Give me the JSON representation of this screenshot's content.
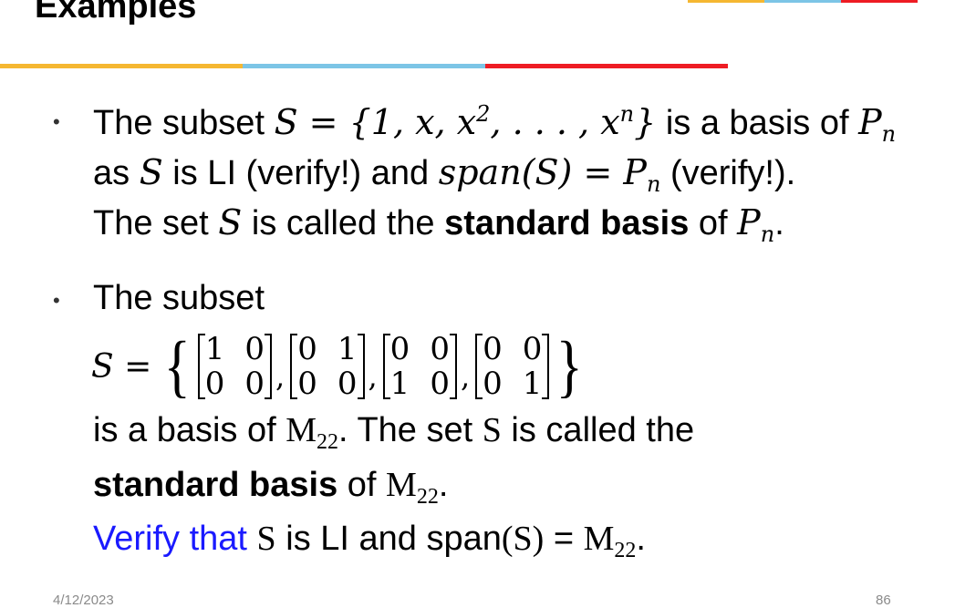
{
  "slide": {
    "title": "Examples",
    "top_accent_colors": [
      "#f5b731",
      "#7cc5e6",
      "#ee1c24"
    ],
    "rule_colors": [
      "#f5b731",
      "#7cc5e6",
      "#ee1c24"
    ],
    "bullet_glyph": "•"
  },
  "bullet1": {
    "l1_a": "The subset ",
    "l1_math": "S = {1, x, x",
    "l1_sup2": "2",
    "l1_math2": ", . . . , x",
    "l1_supn": "n",
    "l1_close": "}",
    "l1_b": " is a basis of ",
    "l1_P": "P",
    "l1_n": "n",
    "l2_a": "as ",
    "l2_S": "S",
    "l2_b": " is LI (verify!) and ",
    "l2_span": "span(S) = P",
    "l2_n": "n",
    "l2_c": " (verify!).",
    "l3_a": "The set ",
    "l3_S": "S",
    "l3_b": " is called the ",
    "l3_bold": "standard basis",
    "l3_c": " of ",
    "l3_P": "P",
    "l3_n": "n",
    "l3_dot": "."
  },
  "bullet2": {
    "l1": "The subset",
    "set_lhs": "S =",
    "matrices": [
      [
        "1",
        "0",
        "0",
        "0"
      ],
      [
        "0",
        "1",
        "0",
        "0"
      ],
      [
        "0",
        "0",
        "1",
        "0"
      ],
      [
        "0",
        "0",
        "0",
        "1"
      ]
    ],
    "l3_a": "is a basis of ",
    "l3_M": "M",
    "l3_sub": "22",
    "l3_b": ". The set ",
    "l3_S": "S",
    "l3_c": " is called the",
    "l4_bold": "standard basis",
    "l4_a": " of ",
    "l4_M": "M",
    "l4_sub": "22",
    "l4_dot": ".",
    "l5_blue": "Verify that ",
    "l5_S": "S",
    "l5_a": " is LI and span",
    "l5_S2": "(S)",
    "l5_eq": " = ",
    "l5_M": "M",
    "l5_sub": "22",
    "l5_dot": ".",
    "verify_color": "#1a1aff"
  },
  "footer": {
    "date": "4/12/2023",
    "page": "86"
  }
}
